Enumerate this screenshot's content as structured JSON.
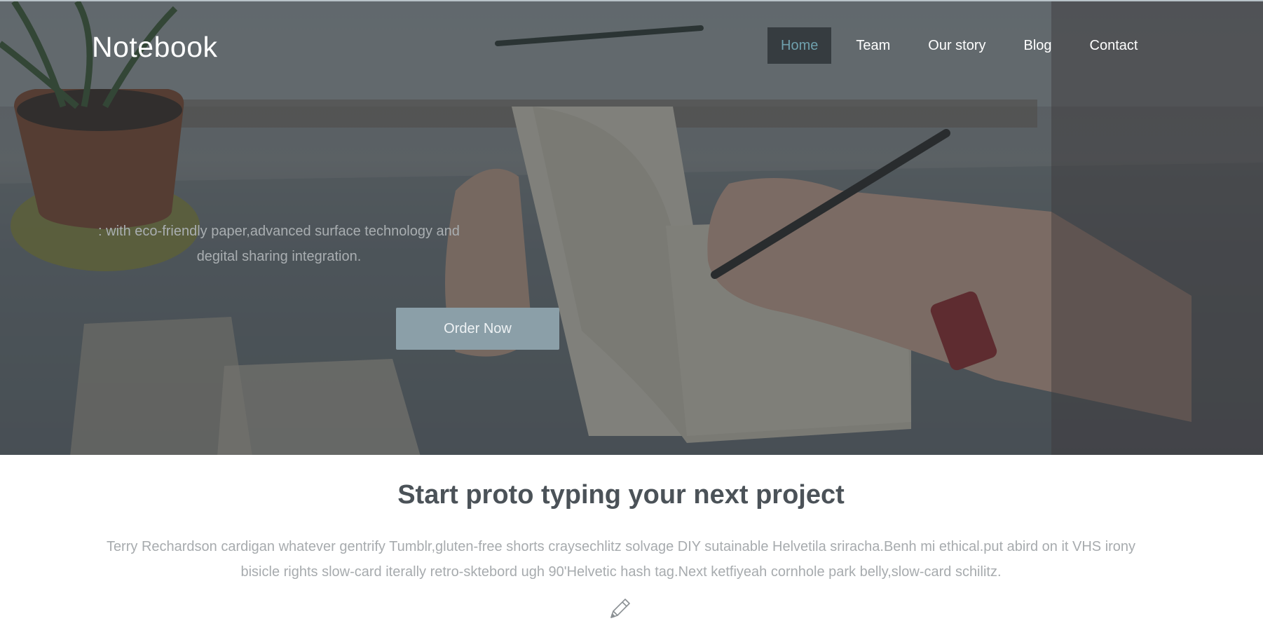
{
  "brand": {
    "name": "Notebook"
  },
  "nav": {
    "items": [
      {
        "label": "Home",
        "active": true
      },
      {
        "label": "Team",
        "active": false
      },
      {
        "label": "Our story",
        "active": false
      },
      {
        "label": "Blog",
        "active": false
      },
      {
        "label": "Contact",
        "active": false
      }
    ]
  },
  "hero": {
    "tagline_line1": ": with eco-friendly paper,advanced surface technology and",
    "tagline_line2": "degital sharing integration.",
    "cta_label": "Order Now"
  },
  "section": {
    "title": "Start proto typing your next project",
    "body_line1": "Terry Rechardson cardigan whatever gentrify Tumblr,gluten-free shorts craysechlitz solvage DIY sutainable Helvetila sriracha.Benh mi ethical.put abird on it VHS irony",
    "body_line2": "bisicle rights slow-card iterally retro-sktebord ugh 90'Helvetic hash tag.Next ketfiyeah cornhole park belly,slow-card schilitz.",
    "icon": "pencil-icon"
  },
  "colors": {
    "accent": "#6fa0ad",
    "cta_bg": "#8b9fa8",
    "title": "#4b5258",
    "body": "#a7abae"
  }
}
